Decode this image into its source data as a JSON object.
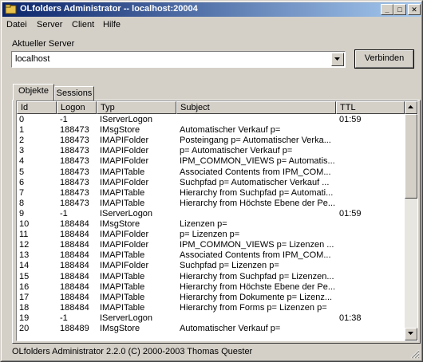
{
  "window": {
    "title": "OLfolders Administrator -- localhost:20004"
  },
  "titlebar_buttons": {
    "minimize": "_",
    "maximize": "□",
    "close": "✕"
  },
  "menu": [
    "Datei",
    "Server",
    "Client",
    "Hilfe"
  ],
  "server": {
    "label": "Aktueller Server",
    "value": "localhost",
    "connect_label": "Verbinden"
  },
  "tabs": [
    {
      "label": "Objekte",
      "active": true
    },
    {
      "label": "Sessions",
      "active": false
    }
  ],
  "columns": [
    "Id",
    "Logon",
    "Typ",
    "Subject",
    "TTL"
  ],
  "rows": [
    {
      "id": "0",
      "logon": "-1",
      "typ": "IServerLogon",
      "subject": "",
      "ttl": "01:59"
    },
    {
      "id": "1",
      "logon": "188473",
      "typ": "IMsgStore",
      "subject": "Automatischer Verkauf p=",
      "ttl": ""
    },
    {
      "id": "2",
      "logon": "188473",
      "typ": "IMAPIFolder",
      "subject": "Posteingang p= Automatischer Verka...",
      "ttl": ""
    },
    {
      "id": "3",
      "logon": "188473",
      "typ": "IMAPIFolder",
      "subject": " p= Automatischer Verkauf p=",
      "ttl": ""
    },
    {
      "id": "4",
      "logon": "188473",
      "typ": "IMAPIFolder",
      "subject": "IPM_COMMON_VIEWS p= Automatis...",
      "ttl": ""
    },
    {
      "id": "5",
      "logon": "188473",
      "typ": "IMAPITable",
      "subject": "Associated Contents from IPM_COM...",
      "ttl": ""
    },
    {
      "id": "6",
      "logon": "188473",
      "typ": "IMAPIFolder",
      "subject": "Suchpfad p= Automatischer Verkauf ...",
      "ttl": ""
    },
    {
      "id": "7",
      "logon": "188473",
      "typ": "IMAPITable",
      "subject": "Hierarchy from Suchpfad p= Automati...",
      "ttl": ""
    },
    {
      "id": "8",
      "logon": "188473",
      "typ": "IMAPITable",
      "subject": "Hierarchy from Höchste Ebene der Pe...",
      "ttl": ""
    },
    {
      "id": "9",
      "logon": "-1",
      "typ": "IServerLogon",
      "subject": "",
      "ttl": "01:59"
    },
    {
      "id": "10",
      "logon": "188484",
      "typ": "IMsgStore",
      "subject": "Lizenzen p=",
      "ttl": ""
    },
    {
      "id": "11",
      "logon": "188484",
      "typ": "IMAPIFolder",
      "subject": " p= Lizenzen p=",
      "ttl": ""
    },
    {
      "id": "12",
      "logon": "188484",
      "typ": "IMAPIFolder",
      "subject": "IPM_COMMON_VIEWS p= Lizenzen ...",
      "ttl": ""
    },
    {
      "id": "13",
      "logon": "188484",
      "typ": "IMAPITable",
      "subject": "Associated Contents from IPM_COM...",
      "ttl": ""
    },
    {
      "id": "14",
      "logon": "188484",
      "typ": "IMAPIFolder",
      "subject": "Suchpfad p= Lizenzen p=",
      "ttl": ""
    },
    {
      "id": "15",
      "logon": "188484",
      "typ": "IMAPITable",
      "subject": "Hierarchy from Suchpfad p= Lizenzen...",
      "ttl": ""
    },
    {
      "id": "16",
      "logon": "188484",
      "typ": "IMAPITable",
      "subject": "Hierarchy from Höchste Ebene der Pe...",
      "ttl": ""
    },
    {
      "id": "17",
      "logon": "188484",
      "typ": "IMAPITable",
      "subject": "Hierarchy from Dokumente p= Lizenz...",
      "ttl": ""
    },
    {
      "id": "18",
      "logon": "188484",
      "typ": "IMAPITable",
      "subject": "Hierarchy from Forms p= Lizenzen p=",
      "ttl": ""
    },
    {
      "id": "19",
      "logon": "-1",
      "typ": "IServerLogon",
      "subject": "",
      "ttl": "01:38"
    },
    {
      "id": "20",
      "logon": "188489",
      "typ": "IMsgStore",
      "subject": "Automatischer Verkauf p=",
      "ttl": ""
    }
  ],
  "status": {
    "text": "OLfolders Administrator 2.2.0 (C) 2000-2003 Thomas Quester"
  },
  "colors": {
    "title_start": "#0a246a",
    "title_end": "#a6caf0",
    "face": "#d4d0c8"
  }
}
